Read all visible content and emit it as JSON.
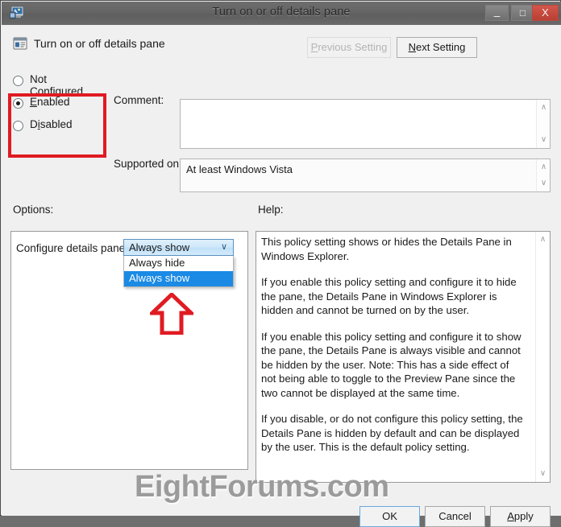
{
  "window": {
    "title": "Turn on or off details pane",
    "icon": "policy-editor-icon",
    "controls": {
      "minimize": "–",
      "maximize": "□",
      "close": "X"
    }
  },
  "header": {
    "icon": "policy-setting-icon",
    "title": "Turn on or off details pane",
    "previous_setting": "Previous Setting",
    "previous_setting_disabled": true,
    "next_setting": "Next Setting"
  },
  "state_options": {
    "items": [
      {
        "label": "Not Configured",
        "accel": "C",
        "selected": false
      },
      {
        "label": "Enabled",
        "accel": "E",
        "selected": true
      },
      {
        "label": "Disabled",
        "accel": "i",
        "selected": false
      }
    ],
    "highlight_color": "#e01b22"
  },
  "comment": {
    "label": "Comment:",
    "value": "",
    "placeholder": ""
  },
  "supported": {
    "label": "Supported on:",
    "value": "At least Windows Vista"
  },
  "options": {
    "label": "Options:",
    "setting_label": "Configure details pane",
    "dropdown": {
      "selected": "Always show",
      "caret": "∨",
      "items": [
        {
          "label": "Always hide",
          "selected": false
        },
        {
          "label": "Always show",
          "selected": true
        }
      ],
      "highlight_color": "#1a8ae5"
    },
    "annotation": "red-up-arrow"
  },
  "help": {
    "label": "Help:",
    "paragraphs": [
      "This policy setting shows or hides the Details Pane in Windows Explorer.",
      "If you enable this policy setting and configure it to hide the pane, the Details Pane in Windows Explorer is hidden and cannot be turned on by the user.",
      "If you enable this policy setting and configure it to show the pane, the Details Pane is always visible and cannot be hidden by the user. Note: This has a side effect of not being able to toggle to the Preview Pane since the two cannot be displayed at the same time.",
      "If you disable, or do not configure this policy setting, the Details Pane is hidden by default and can be displayed by the user. This is the default policy setting."
    ]
  },
  "watermark": "EightForums.com",
  "footer": {
    "ok": "OK",
    "cancel": "Cancel",
    "apply": "Apply",
    "apply_accel": "A"
  },
  "scrollbar": {
    "up_arrow": "∧",
    "down_arrow": "∨"
  }
}
